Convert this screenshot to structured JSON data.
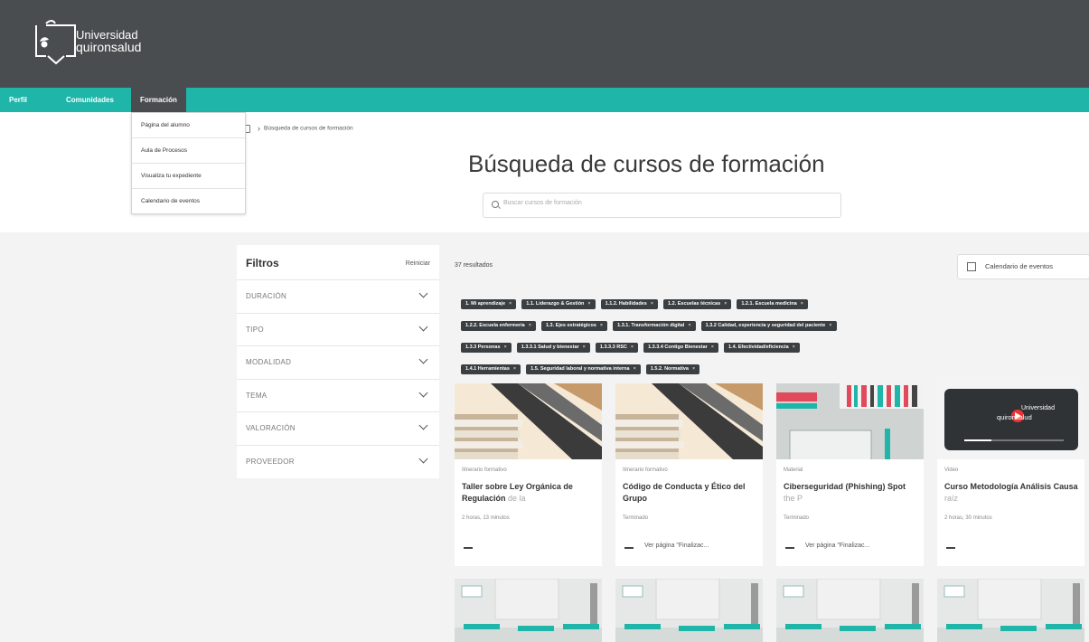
{
  "brand": {
    "line1": "Universidad",
    "line2": "quironsalud"
  },
  "nav": {
    "items": [
      "Perfil",
      "Comunidades",
      "Formación"
    ],
    "active": "Formación"
  },
  "dropdown": {
    "items": [
      "Página del alumno",
      "Aula de Procesos",
      "Visualiza tu expediente",
      "Calendario de eventos"
    ]
  },
  "breadcrumb": {
    "current": "Búsqueda de cursos de formación"
  },
  "page": {
    "title": "Búsqueda de cursos de formación"
  },
  "search": {
    "placeholder": "Buscar cursos de formación"
  },
  "filters": {
    "title": "Filtros",
    "reset": "Reiniciar",
    "groups": [
      "DURACIÓN",
      "TIPO",
      "MODALIDAD",
      "TEMA",
      "VALORACIÓN",
      "PROVEEDOR"
    ]
  },
  "results": {
    "count": "37 resultados",
    "calendar_button": "Calendario de eventos"
  },
  "chips": [
    "1. Mi aprendizaje",
    "1.1. Liderazgo & Gestión",
    "1.1.2. Habilidades",
    "1.2. Escuelas técnicas",
    "1.2.1. Escuela medicina",
    "1.2.2. Escuela enfermería",
    "1.3. Ejes estratégicos",
    "1.3.1. Transformación digital",
    "1.3.2 Calidad, experiencia y seguridad del paciente",
    "1.3.3 Personas",
    "1.3.3.1 Salud y bienestar",
    "1.3.3.3 RSC",
    "1.3.3.4 Contigo Bienestar",
    "1.4. Efectividad/eficiencia",
    "1.4.1 Herramientas",
    "1.5. Seguridad laboral y normativa interna",
    "1.5.2. Normativa"
  ],
  "chip_close": "×",
  "cards": [
    {
      "type": "Itinerario formativo",
      "title": "Taller sobre Ley Orgánica de Regulación",
      "title_fade": "de la",
      "sub": "2 horas, 13 minutos",
      "link": ""
    },
    {
      "type": "Itinerario formativo",
      "title": "Código de Conducta y Ético del Grupo",
      "title_fade": "",
      "sub": "Terminado",
      "link": "Ver página \"Finalizac..."
    },
    {
      "type": "Material",
      "title": "Ciberseguridad (Phishing) Spot",
      "title_fade": "the P",
      "sub": "Terminado",
      "link": "Ver página \"Finalizac..."
    },
    {
      "type": "Video",
      "title": "Curso Metodología Análisis Causa",
      "title_fade": "raíz",
      "sub": "2 horas, 30 minutos",
      "link": ""
    }
  ],
  "thumbnail_brand": {
    "line1": "Universidad",
    "line2": "quironsalud"
  },
  "colors": {
    "header": "#4a4d4f",
    "nav": "#1fb5a9",
    "chip": "#3b3f42"
  }
}
